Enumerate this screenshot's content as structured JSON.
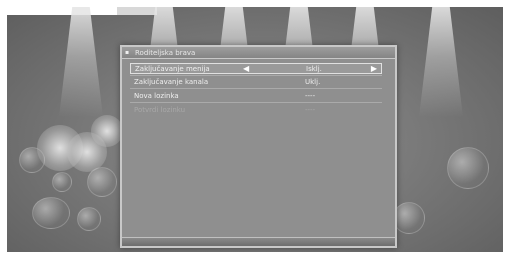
{
  "menu": {
    "title": "Roditeljska brava",
    "items": [
      {
        "label": "Zaključavanje menija",
        "value": "Isklj.",
        "left_arrow": "◀",
        "right_arrow": "▶"
      },
      {
        "label": "Zaključavanje kanala",
        "value": "Uklj."
      },
      {
        "label": "Nova lozinka",
        "value": "----"
      },
      {
        "label": "Potvrdi lozinku",
        "value": "----"
      }
    ]
  },
  "colors": {
    "panel": "#8f8f8f",
    "border": "#c8c8c8",
    "text": "#efefef",
    "disabled_text": "#a8a8a8"
  }
}
